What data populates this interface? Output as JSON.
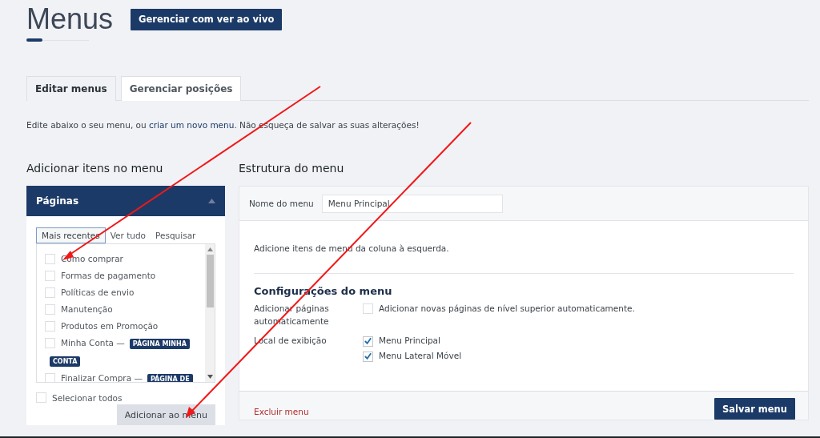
{
  "title": "Menus",
  "live_button": "Gerenciar com ver ao vivo",
  "tabs": [
    {
      "label": "Editar menus",
      "selected": true
    },
    {
      "label": "Gerenciar posições",
      "selected": false
    }
  ],
  "description": {
    "before": "Edite abaixo o seu menu, ou ",
    "link": "criar um novo menu",
    "after": ". Não esqueça de salvar as suas alterações!"
  },
  "add_items": {
    "heading": "Adicionar itens no menu",
    "panel_title": "Páginas",
    "subtabs": [
      {
        "label": "Mais recentes",
        "selected": true
      },
      {
        "label": "Ver tudo",
        "selected": false
      },
      {
        "label": "Pesquisar",
        "selected": false
      }
    ],
    "pages": [
      {
        "label": "Como comprar",
        "checked": false
      },
      {
        "label": "Formas de pagamento",
        "checked": false
      },
      {
        "label": "Políticas de envio",
        "checked": false
      },
      {
        "label": "Manutenção",
        "checked": false
      },
      {
        "label": "Produtos em Promoção",
        "checked": false
      },
      {
        "label": "Minha Conta —",
        "checked": false,
        "badge": "PÁGINA MINHA CONTA"
      },
      {
        "label": "Finalizar Compra —",
        "checked": false,
        "badge": "PÁGINA DE"
      }
    ],
    "select_all": {
      "label": "Selecionar todos",
      "checked": false
    },
    "add_button": "Adicionar ao menu"
  },
  "structure": {
    "heading": "Estrutura do menu",
    "name_label": "Nome do menu",
    "name_value": "Menu Principal",
    "hint": "Adicione itens de menu da coluna à esquerda.",
    "settings_heading": "Configurações do menu",
    "settings": [
      {
        "label": "Adicionar páginas automaticamente",
        "options": [
          {
            "label": "Adicionar novas páginas de nível superior automaticamente.",
            "checked": false
          }
        ]
      },
      {
        "label": "Local de exibição",
        "options": [
          {
            "label": "Menu Principal",
            "checked": true
          },
          {
            "label": "Menu Lateral Móvel",
            "checked": true
          }
        ]
      }
    ],
    "delete_link": "Excluir menu",
    "save_button": "Salvar menu"
  }
}
